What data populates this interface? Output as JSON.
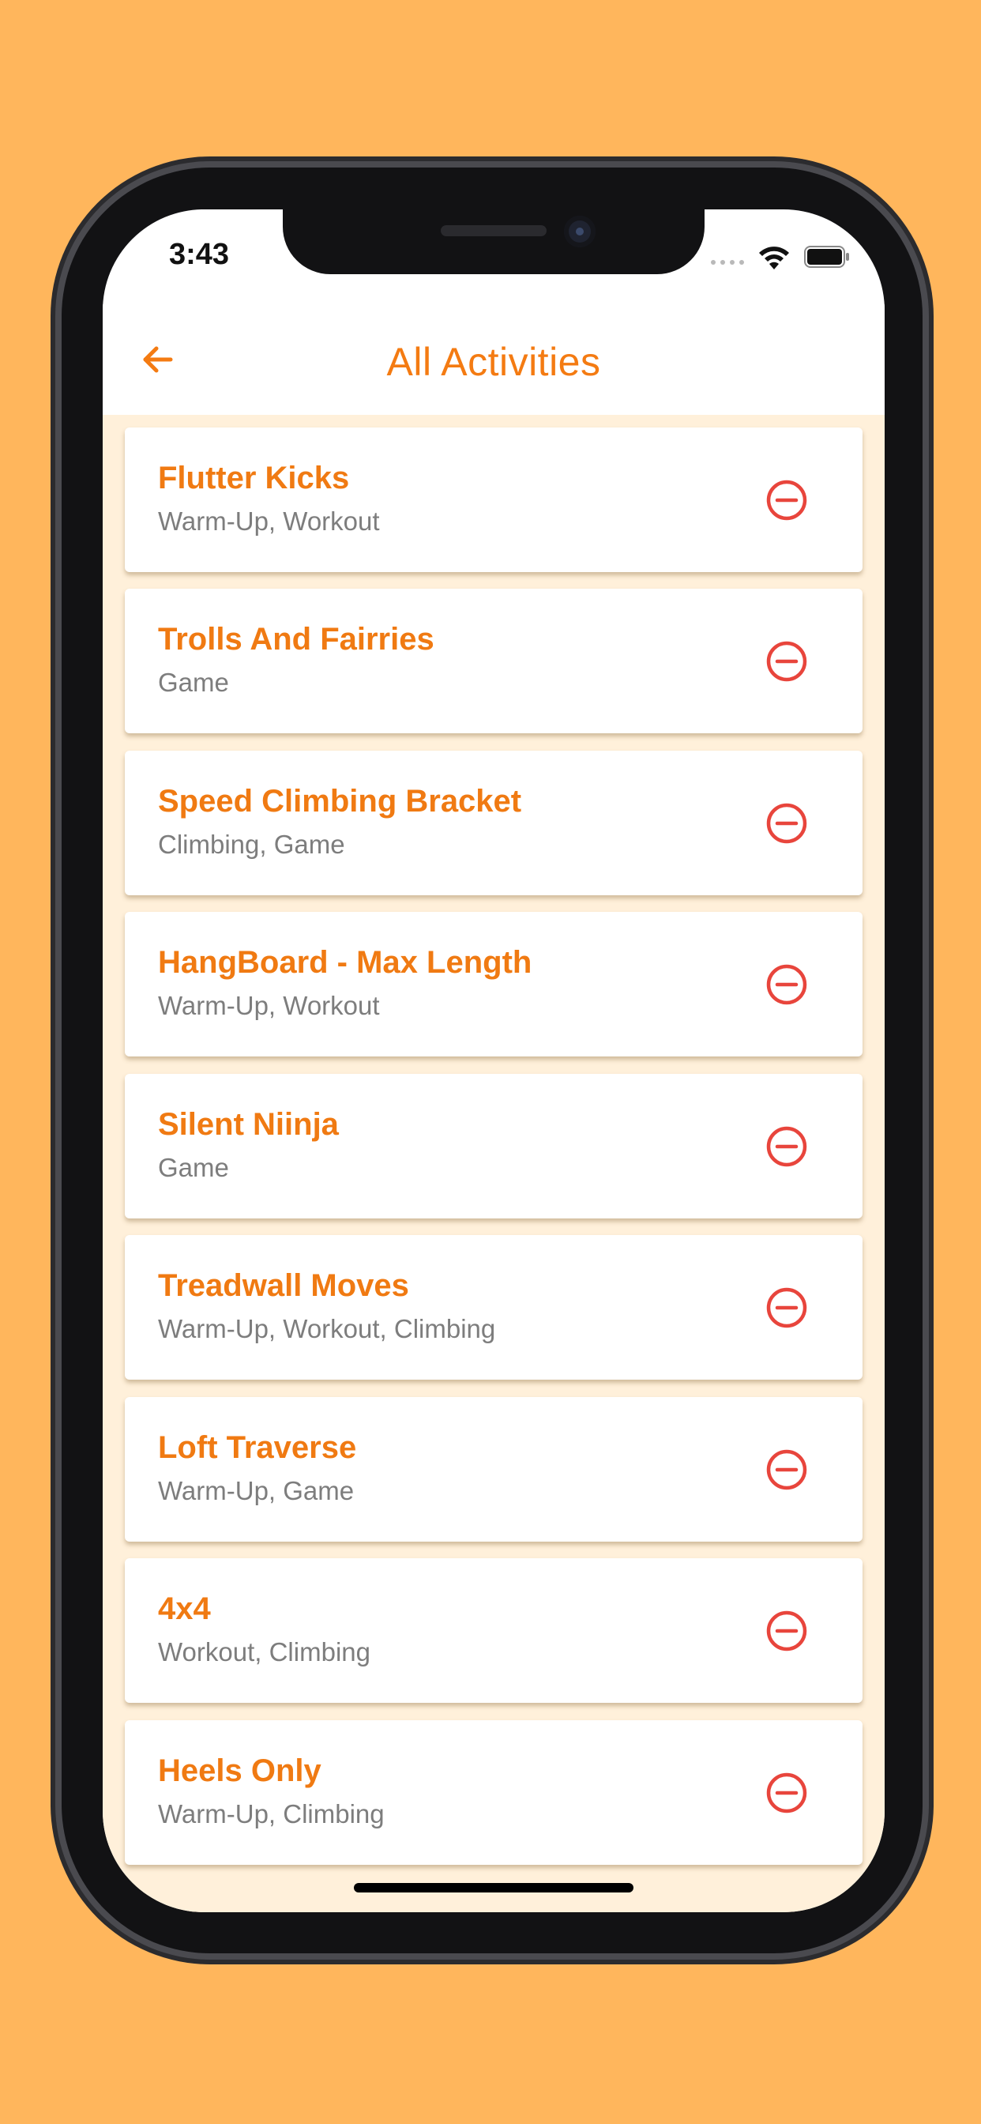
{
  "status_bar": {
    "time": "3:43"
  },
  "header": {
    "title": "All Activities",
    "back_icon": "arrow-left-icon"
  },
  "colors": {
    "accent": "#F47B12",
    "background": "#FFB65C",
    "list_background": "#FFF0DA",
    "remove": "#E8453C",
    "subtitle": "#7D7D7D"
  },
  "activities": [
    {
      "title": "Flutter Kicks",
      "tags": "Warm-Up, Workout"
    },
    {
      "title": "Trolls And Fairries",
      "tags": "Game"
    },
    {
      "title": "Speed Climbing Bracket",
      "tags": "Climbing, Game"
    },
    {
      "title": "HangBoard - Max Length",
      "tags": "Warm-Up, Workout"
    },
    {
      "title": "Silent Niinja",
      "tags": "Game"
    },
    {
      "title": "Treadwall Moves",
      "tags": "Warm-Up, Workout, Climbing"
    },
    {
      "title": "Loft Traverse",
      "tags": "Warm-Up, Game"
    },
    {
      "title": "4x4",
      "tags": "Workout, Climbing"
    },
    {
      "title": "Heels Only",
      "tags": "Warm-Up, Climbing"
    }
  ]
}
